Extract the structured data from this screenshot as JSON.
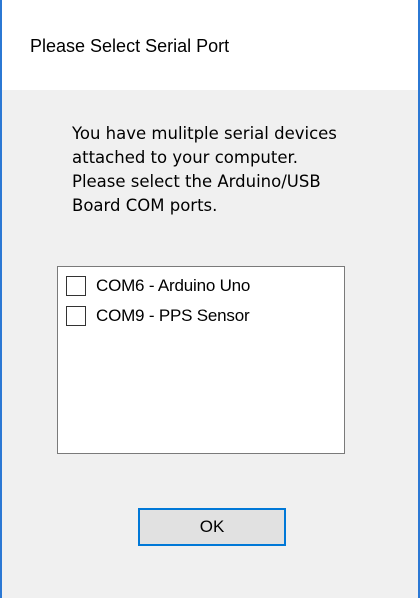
{
  "dialog": {
    "title": "Please Select Serial Port",
    "message_lines": [
      "You have mulitple serial devices",
      "attached to your computer.",
      "Please select the Arduino/USB",
      "Board COM ports."
    ],
    "ports": [
      {
        "label": "COM6 - Arduino Uno",
        "checked": false
      },
      {
        "label": "COM9 - PPS Sensor",
        "checked": false
      }
    ],
    "ok_label": "OK"
  },
  "colors": {
    "window_border": "#2b78d4",
    "dialog_background": "#f0f0f0",
    "button_focus_border": "#0078d7",
    "button_face": "#e1e1e1"
  }
}
